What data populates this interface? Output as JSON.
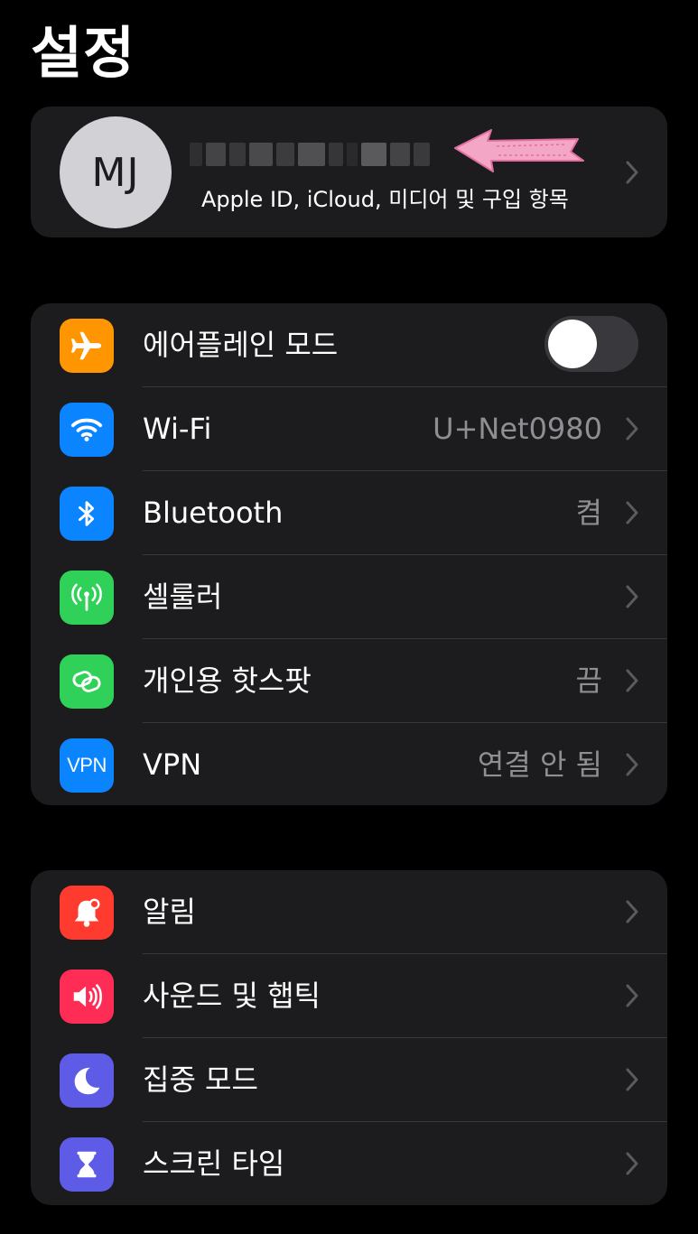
{
  "header": {
    "title": "설정"
  },
  "profile": {
    "initials": "MJ",
    "subtitle": "Apple ID, iCloud, 미디어 및 구입 항목"
  },
  "colors": {
    "airplane": "#ff9500",
    "wifi": "#0a84ff",
    "bluetooth": "#0a84ff",
    "cellular": "#30d158",
    "hotspot": "#30d158",
    "vpn": "#0a84ff",
    "notifications": "#ff3b30",
    "sounds": "#ff2d55",
    "focus": "#5e5ce6",
    "screen_time": "#5e5ce6"
  },
  "connectivity": {
    "airplane": {
      "label": "에어플레인 모드",
      "icon": "airplane-icon",
      "toggle_on": false
    },
    "wifi": {
      "label": "Wi-Fi",
      "value": "U+Net0980",
      "icon": "wifi-icon"
    },
    "bluetooth": {
      "label": "Bluetooth",
      "value": "켬",
      "icon": "bluetooth-icon"
    },
    "cellular": {
      "label": "셀룰러",
      "icon": "antenna-icon"
    },
    "hotspot": {
      "label": "개인용 핫스팟",
      "value": "끔",
      "icon": "chain-link-icon"
    },
    "vpn": {
      "label": "VPN",
      "value": "연결 안 됨",
      "icon_text": "VPN"
    }
  },
  "general": {
    "notifications": {
      "label": "알림",
      "icon": "bell-icon"
    },
    "sounds": {
      "label": "사운드 및 햅틱",
      "icon": "speaker-icon"
    },
    "focus": {
      "label": "집중 모드",
      "icon": "moon-icon"
    },
    "screen_time": {
      "label": "스크린 타임",
      "icon": "hourglass-icon"
    }
  }
}
